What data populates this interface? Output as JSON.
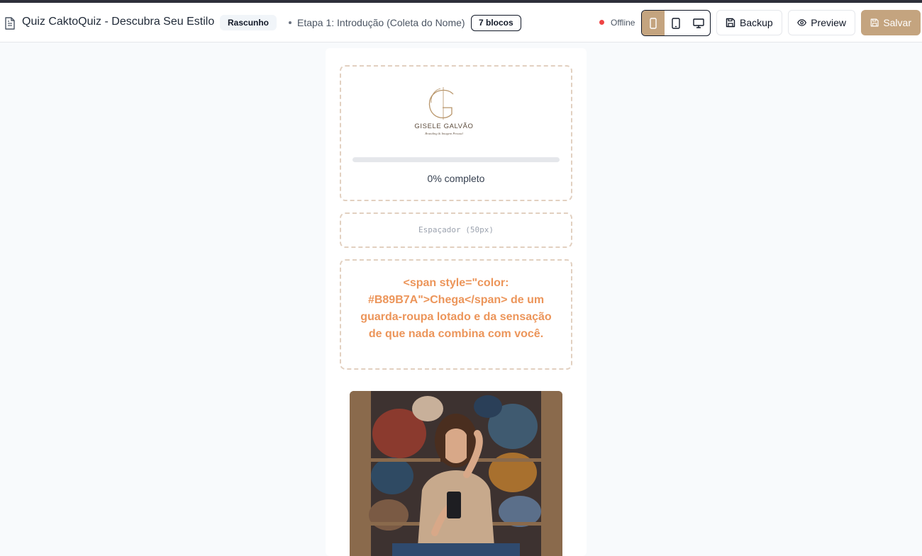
{
  "header": {
    "title": "Quiz CaktoQuiz - Descubra Seu Estilo",
    "draft_badge": "Rascunho",
    "stage": "Etapa 1: Introdução (Coleta do Nome)",
    "blocks_badge": "7 blocos",
    "status": "Offline",
    "backup_label": "Backup",
    "preview_label": "Preview",
    "save_label": "Salvar"
  },
  "colors": {
    "accent": "#c4a47f",
    "heading_text": "#ec955a",
    "status_offline": "#ef4444",
    "dashed_border": "#e2d0c0"
  },
  "devices": {
    "active": "mobile",
    "items": [
      "mobile-icon",
      "tablet-icon",
      "desktop-icon"
    ]
  },
  "canvas": {
    "logo": {
      "name": "GISELE GALVÃO",
      "tagline": "Branding & Imagem Pessoal"
    },
    "progress": {
      "value": 0,
      "label": "0% completo"
    },
    "spacer_label": "Espaçador (50px)",
    "heading": "<span style=\"color: #B89B7A\">Chega</span> de um guarda-roupa lotado e da sensação de que nada combina com você.",
    "image_icon": "photo-woman-with-phone-icon"
  }
}
